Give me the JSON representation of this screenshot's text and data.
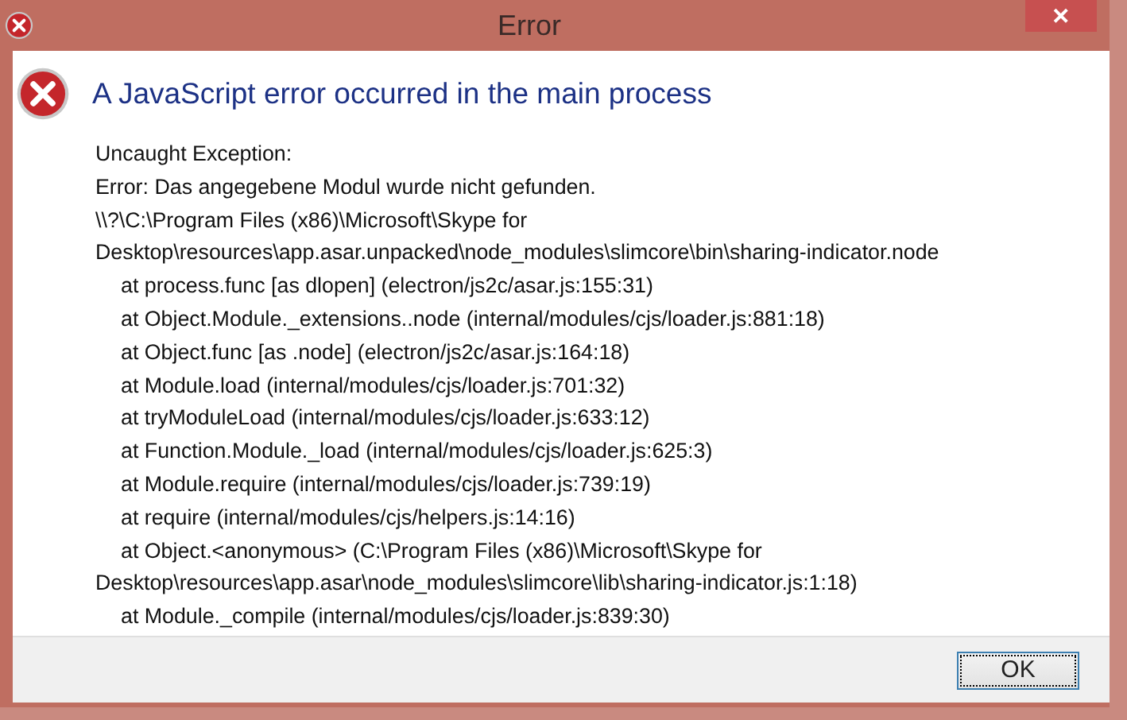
{
  "window": {
    "title": "Error",
    "close_label": "✕"
  },
  "heading": "A JavaScript error occurred in the main process",
  "message_lines": [
    {
      "kind": "line",
      "text": "Uncaught Exception:"
    },
    {
      "kind": "line",
      "text": "Error: Das angegebene Modul wurde nicht gefunden."
    },
    {
      "kind": "line",
      "text": "\\\\?\\C:\\Program Files (x86)\\Microsoft\\Skype for"
    },
    {
      "kind": "line",
      "text": "Desktop\\resources\\app.asar.unpacked\\node_modules\\slimcore\\bin\\sharing-indicator.node"
    },
    {
      "kind": "frame",
      "text": "at process.func [as dlopen] (electron/js2c/asar.js:155:31)"
    },
    {
      "kind": "frame",
      "text": "at Object.Module._extensions..node (internal/modules/cjs/loader.js:881:18)"
    },
    {
      "kind": "frame",
      "text": "at Object.func [as .node] (electron/js2c/asar.js:164:18)"
    },
    {
      "kind": "frame",
      "text": "at Module.load (internal/modules/cjs/loader.js:701:32)"
    },
    {
      "kind": "frame",
      "text": "at tryModuleLoad (internal/modules/cjs/loader.js:633:12)"
    },
    {
      "kind": "frame",
      "text": "at Function.Module._load (internal/modules/cjs/loader.js:625:3)"
    },
    {
      "kind": "frame",
      "text": "at Module.require (internal/modules/cjs/loader.js:739:19)"
    },
    {
      "kind": "frame",
      "text": "at require (internal/modules/cjs/helpers.js:14:16)"
    },
    {
      "kind": "frame",
      "text": "at Object.<anonymous> (C:\\Program Files (x86)\\Microsoft\\Skype for"
    },
    {
      "kind": "line",
      "text": "Desktop\\resources\\app.asar\\node_modules\\slimcore\\lib\\sharing-indicator.js:1:18)"
    },
    {
      "kind": "frame",
      "text": "at Module._compile (internal/modules/cjs/loader.js:839:30)"
    }
  ],
  "buttons": [
    {
      "label": "OK",
      "focused": true
    }
  ]
}
